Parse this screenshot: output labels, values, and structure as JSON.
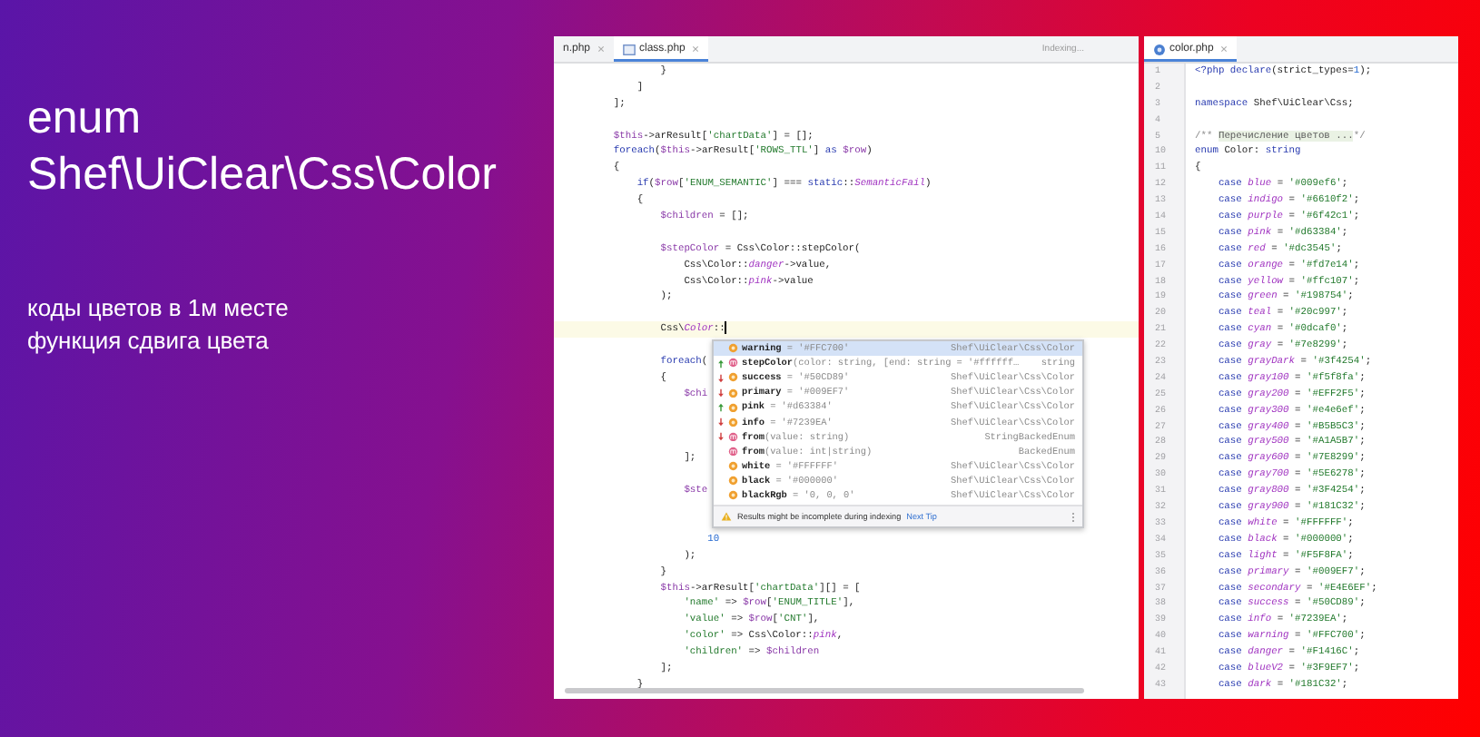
{
  "headline": [
    "enum",
    "Shef\\UiClear\\Css\\Color"
  ],
  "notes": [
    "коды цветов в 1м месте",
    "функция сдвига цвета"
  ],
  "left_editor": {
    "tabs": [
      {
        "label": "n.php",
        "selected": false
      },
      {
        "label": "class.php",
        "selected": true
      }
    ],
    "status": "Indexing...",
    "lines": [
      {
        "kind": "code",
        "current": false,
        "segments": [
          {
            "kind": "plain",
            "text": "                }"
          }
        ]
      },
      {
        "kind": "code",
        "current": false,
        "segments": [
          {
            "kind": "plain",
            "text": "            ]"
          }
        ]
      },
      {
        "kind": "code",
        "current": false,
        "segments": [
          {
            "kind": "plain",
            "text": "        ];"
          }
        ]
      },
      {
        "kind": "blank",
        "current": false
      },
      {
        "kind": "code",
        "current": false,
        "segments": [
          {
            "kind": "var",
            "text": "        $this"
          },
          {
            "kind": "plain",
            "text": "->arResult["
          },
          {
            "kind": "str",
            "text": "'chartData'"
          },
          {
            "kind": "plain",
            "text": "] = [];"
          }
        ]
      },
      {
        "kind": "code",
        "current": false,
        "segments": [
          {
            "kind": "kw",
            "text": "        foreach"
          },
          {
            "kind": "plain",
            "text": "("
          },
          {
            "kind": "var",
            "text": "$this"
          },
          {
            "kind": "plain",
            "text": "->arResult["
          },
          {
            "kind": "str",
            "text": "'ROWS_TTL'"
          },
          {
            "kind": "plain",
            "text": "] "
          },
          {
            "kind": "kw",
            "text": "as "
          },
          {
            "kind": "var",
            "text": "$row"
          },
          {
            "kind": "plain",
            "text": ")"
          }
        ]
      },
      {
        "kind": "code",
        "current": false,
        "segments": [
          {
            "kind": "plain",
            "text": "        {"
          }
        ]
      },
      {
        "kind": "code",
        "current": false,
        "segments": [
          {
            "kind": "kw",
            "text": "            if"
          },
          {
            "kind": "plain",
            "text": "("
          },
          {
            "kind": "var",
            "text": "$row"
          },
          {
            "kind": "plain",
            "text": "["
          },
          {
            "kind": "str",
            "text": "'ENUM_SEMANTIC'"
          },
          {
            "kind": "plain",
            "text": "] === "
          },
          {
            "kind": "kw",
            "text": "static"
          },
          {
            "kind": "plain",
            "text": "::"
          },
          {
            "kind": "const",
            "text": "SemanticFail"
          },
          {
            "kind": "plain",
            "text": ")"
          }
        ]
      },
      {
        "kind": "code",
        "current": false,
        "segments": [
          {
            "kind": "plain",
            "text": "            {"
          }
        ]
      },
      {
        "kind": "code",
        "current": false,
        "segments": [
          {
            "kind": "var",
            "text": "                $children"
          },
          {
            "kind": "plain",
            "text": " = [];"
          }
        ]
      },
      {
        "kind": "blank",
        "current": false
      },
      {
        "kind": "code",
        "current": false,
        "segments": [
          {
            "kind": "var",
            "text": "                $stepColor"
          },
          {
            "kind": "plain",
            "text": " = Css\\Color::stepColor("
          }
        ]
      },
      {
        "kind": "code",
        "current": false,
        "segments": [
          {
            "kind": "plain",
            "text": "                    Css\\Color::"
          },
          {
            "kind": "const",
            "text": "danger"
          },
          {
            "kind": "plain",
            "text": "->value,"
          }
        ]
      },
      {
        "kind": "code",
        "current": false,
        "segments": [
          {
            "kind": "plain",
            "text": "                    Css\\Color::"
          },
          {
            "kind": "const",
            "text": "pink"
          },
          {
            "kind": "plain",
            "text": "->value"
          }
        ]
      },
      {
        "kind": "code",
        "current": false,
        "segments": [
          {
            "kind": "plain",
            "text": "                );"
          }
        ]
      },
      {
        "kind": "blank",
        "current": false
      },
      {
        "kind": "code",
        "current": true,
        "segments": [
          {
            "kind": "plain",
            "text": "                Css\\"
          },
          {
            "kind": "const",
            "text": "Color"
          },
          {
            "kind": "plain",
            "text": "::"
          }
        ]
      },
      {
        "kind": "blank",
        "current": false
      },
      {
        "kind": "code",
        "current": false,
        "segments": [
          {
            "kind": "kw",
            "text": "                foreach"
          },
          {
            "kind": "plain",
            "text": "("
          }
        ]
      },
      {
        "kind": "code",
        "current": false,
        "segments": [
          {
            "kind": "plain",
            "text": "                {"
          }
        ]
      },
      {
        "kind": "code",
        "current": false,
        "segments": [
          {
            "kind": "var",
            "text": "                    $chi"
          }
        ]
      },
      {
        "kind": "blank",
        "current": false
      },
      {
        "kind": "blank",
        "current": false
      },
      {
        "kind": "blank",
        "current": false
      },
      {
        "kind": "code",
        "current": false,
        "segments": [
          {
            "kind": "plain",
            "text": "                    ];"
          }
        ]
      },
      {
        "kind": "blank",
        "current": false
      },
      {
        "kind": "code",
        "current": false,
        "segments": [
          {
            "kind": "var",
            "text": "                    $ste"
          }
        ]
      },
      {
        "kind": "blank",
        "current": false
      },
      {
        "kind": "blank",
        "current": false
      },
      {
        "kind": "code",
        "current": false,
        "segments": [
          {
            "kind": "num",
            "text": "                        10"
          }
        ]
      },
      {
        "kind": "code",
        "current": false,
        "segments": [
          {
            "kind": "plain",
            "text": "                    );"
          }
        ]
      },
      {
        "kind": "code",
        "current": false,
        "segments": [
          {
            "kind": "plain",
            "text": "                }"
          }
        ]
      },
      {
        "kind": "code",
        "current": false,
        "segments": [
          {
            "kind": "var",
            "text": "                $this"
          },
          {
            "kind": "plain",
            "text": "->arResult["
          },
          {
            "kind": "str",
            "text": "'chartData'"
          },
          {
            "kind": "plain",
            "text": "][] = ["
          }
        ]
      },
      {
        "kind": "code",
        "current": false,
        "segments": [
          {
            "kind": "str",
            "text": "                    'name'"
          },
          {
            "kind": "plain",
            "text": " => "
          },
          {
            "kind": "var",
            "text": "$row"
          },
          {
            "kind": "plain",
            "text": "["
          },
          {
            "kind": "str",
            "text": "'ENUM_TITLE'"
          },
          {
            "kind": "plain",
            "text": "],"
          }
        ]
      },
      {
        "kind": "code",
        "current": false,
        "segments": [
          {
            "kind": "str",
            "text": "                    'value'"
          },
          {
            "kind": "plain",
            "text": " => "
          },
          {
            "kind": "var",
            "text": "$row"
          },
          {
            "kind": "plain",
            "text": "["
          },
          {
            "kind": "str",
            "text": "'CNT'"
          },
          {
            "kind": "plain",
            "text": "],"
          }
        ]
      },
      {
        "kind": "code",
        "current": false,
        "segments": [
          {
            "kind": "str",
            "text": "                    'color'"
          },
          {
            "kind": "plain",
            "text": " => Css\\Color::"
          },
          {
            "kind": "const",
            "text": "pink"
          },
          {
            "kind": "plain",
            "text": ","
          }
        ]
      },
      {
        "kind": "code",
        "current": false,
        "segments": [
          {
            "kind": "str",
            "text": "                    'children'"
          },
          {
            "kind": "plain",
            "text": " => "
          },
          {
            "kind": "var",
            "text": "$children"
          }
        ]
      },
      {
        "kind": "code",
        "current": false,
        "segments": [
          {
            "kind": "plain",
            "text": "                ];"
          }
        ]
      },
      {
        "kind": "code",
        "current": false,
        "segments": [
          {
            "kind": "plain",
            "text": "            }"
          }
        ]
      }
    ],
    "completion": {
      "items": [
        {
          "kind": "field",
          "moved_up": false,
          "moved_down": false,
          "name": "warning",
          "detail": " = '#FFC700'",
          "type": "Shef\\UiClear\\Css\\Color",
          "selected": true
        },
        {
          "kind": "method",
          "moved_up": true,
          "moved_down": false,
          "name": "stepColor",
          "detail": "(color: string, [end: string = '#ffffff…",
          "type": "string",
          "selected": false
        },
        {
          "kind": "field",
          "moved_up": false,
          "moved_down": true,
          "name": "success",
          "detail": " = '#50CD89'",
          "type": "Shef\\UiClear\\Css\\Color",
          "selected": false
        },
        {
          "kind": "field",
          "moved_up": false,
          "moved_down": true,
          "name": "primary",
          "detail": " = '#009EF7'",
          "type": "Shef\\UiClear\\Css\\Color",
          "selected": false
        },
        {
          "kind": "field",
          "moved_up": true,
          "moved_down": false,
          "name": "pink",
          "detail": " = '#d63384'",
          "type": "Shef\\UiClear\\Css\\Color",
          "selected": false
        },
        {
          "kind": "field",
          "moved_up": false,
          "moved_down": true,
          "name": "info",
          "detail": " = '#7239EA'",
          "type": "Shef\\UiClear\\Css\\Color",
          "selected": false
        },
        {
          "kind": "method",
          "moved_up": false,
          "moved_down": true,
          "name": "from",
          "detail": "(value: string)",
          "type": "StringBackedEnum",
          "selected": false
        },
        {
          "kind": "method",
          "moved_up": false,
          "moved_down": false,
          "name": "from",
          "detail": "(value: int|string)",
          "type": "BackedEnum",
          "selected": false
        },
        {
          "kind": "field",
          "moved_up": false,
          "moved_down": false,
          "name": "white",
          "detail": " = '#FFFFFF'",
          "type": "Shef\\UiClear\\Css\\Color",
          "selected": false
        },
        {
          "kind": "field",
          "moved_up": false,
          "moved_down": false,
          "name": "black",
          "detail": " = '#000000'",
          "type": "Shef\\UiClear\\Css\\Color",
          "selected": false
        },
        {
          "kind": "field",
          "moved_up": false,
          "moved_down": false,
          "name": "blackRgb",
          "detail": " = '0, 0, 0'",
          "type": "Shef\\UiClear\\Css\\Color",
          "selected": false
        }
      ],
      "hint": "Results might be incomplete during indexing",
      "hint_link": "Next Tip"
    }
  },
  "right_editor": {
    "tabs": [
      {
        "label": "color.php",
        "selected": true
      }
    ],
    "lines": [
      {
        "number": "1",
        "segments": [
          {
            "kind": "kw",
            "text": "<?php declare"
          },
          {
            "kind": "plain",
            "text": "(strict_types="
          },
          {
            "kind": "num",
            "text": "1"
          },
          {
            "kind": "plain",
            "text": ");"
          }
        ]
      },
      {
        "number": "2"
      },
      {
        "number": "3",
        "segments": [
          {
            "kind": "kw",
            "text": "namespace"
          },
          {
            "kind": "plain",
            "text": " Shef\\UiClear\\Css;"
          }
        ]
      },
      {
        "number": "4"
      },
      {
        "number": "5",
        "segments": [
          {
            "kind": "comment",
            "text": "/** "
          },
          {
            "kind": "fold",
            "text": "Перечисление цветов ..."
          },
          {
            "kind": "comment",
            "text": "*/"
          }
        ]
      },
      {
        "number": "10",
        "segments": [
          {
            "kind": "kw",
            "text": "enum"
          },
          {
            "kind": "plain",
            "text": " Color: "
          },
          {
            "kind": "kw",
            "text": "string"
          }
        ]
      },
      {
        "number": "11",
        "segments": [
          {
            "kind": "plain",
            "text": "{"
          }
        ]
      },
      {
        "number": "12",
        "segments": [
          {
            "kind": "kw",
            "text": "    case "
          },
          {
            "kind": "const",
            "text": "blue"
          },
          {
            "kind": "plain",
            "text": " = "
          },
          {
            "kind": "str",
            "text": "'#009ef6'"
          },
          {
            "kind": "plain",
            "text": ";"
          }
        ]
      },
      {
        "number": "13",
        "segments": [
          {
            "kind": "kw",
            "text": "    case "
          },
          {
            "kind": "const",
            "text": "indigo"
          },
          {
            "kind": "plain",
            "text": " = "
          },
          {
            "kind": "str",
            "text": "'#6610f2'"
          },
          {
            "kind": "plain",
            "text": ";"
          }
        ]
      },
      {
        "number": "14",
        "segments": [
          {
            "kind": "kw",
            "text": "    case "
          },
          {
            "kind": "const",
            "text": "purple"
          },
          {
            "kind": "plain",
            "text": " = "
          },
          {
            "kind": "str",
            "text": "'#6f42c1'"
          },
          {
            "kind": "plain",
            "text": ";"
          }
        ]
      },
      {
        "number": "15",
        "segments": [
          {
            "kind": "kw",
            "text": "    case "
          },
          {
            "kind": "const",
            "text": "pink"
          },
          {
            "kind": "plain",
            "text": " = "
          },
          {
            "kind": "str",
            "text": "'#d63384'"
          },
          {
            "kind": "plain",
            "text": ";"
          }
        ]
      },
      {
        "number": "16",
        "segments": [
          {
            "kind": "kw",
            "text": "    case "
          },
          {
            "kind": "const",
            "text": "red"
          },
          {
            "kind": "plain",
            "text": " = "
          },
          {
            "kind": "str",
            "text": "'#dc3545'"
          },
          {
            "kind": "plain",
            "text": ";"
          }
        ]
      },
      {
        "number": "17",
        "segments": [
          {
            "kind": "kw",
            "text": "    case "
          },
          {
            "kind": "const",
            "text": "orange"
          },
          {
            "kind": "plain",
            "text": " = "
          },
          {
            "kind": "str",
            "text": "'#fd7e14'"
          },
          {
            "kind": "plain",
            "text": ";"
          }
        ]
      },
      {
        "number": "18",
        "segments": [
          {
            "kind": "kw",
            "text": "    case "
          },
          {
            "kind": "const",
            "text": "yellow"
          },
          {
            "kind": "plain",
            "text": " = "
          },
          {
            "kind": "str",
            "text": "'#ffc107'"
          },
          {
            "kind": "plain",
            "text": ";"
          }
        ]
      },
      {
        "number": "19",
        "segments": [
          {
            "kind": "kw",
            "text": "    case "
          },
          {
            "kind": "const",
            "text": "green"
          },
          {
            "kind": "plain",
            "text": " = "
          },
          {
            "kind": "str",
            "text": "'#198754'"
          },
          {
            "kind": "plain",
            "text": ";"
          }
        ]
      },
      {
        "number": "20",
        "segments": [
          {
            "kind": "kw",
            "text": "    case "
          },
          {
            "kind": "const",
            "text": "teal"
          },
          {
            "kind": "plain",
            "text": " = "
          },
          {
            "kind": "str",
            "text": "'#20c997'"
          },
          {
            "kind": "plain",
            "text": ";"
          }
        ]
      },
      {
        "number": "21",
        "segments": [
          {
            "kind": "kw",
            "text": "    case "
          },
          {
            "kind": "const",
            "text": "cyan"
          },
          {
            "kind": "plain",
            "text": " = "
          },
          {
            "kind": "str",
            "text": "'#0dcaf0'"
          },
          {
            "kind": "plain",
            "text": ";"
          }
        ]
      },
      {
        "number": "22",
        "segments": [
          {
            "kind": "kw",
            "text": "    case "
          },
          {
            "kind": "const",
            "text": "gray"
          },
          {
            "kind": "plain",
            "text": " = "
          },
          {
            "kind": "str",
            "text": "'#7e8299'"
          },
          {
            "kind": "plain",
            "text": ";"
          }
        ]
      },
      {
        "number": "23",
        "segments": [
          {
            "kind": "kw",
            "text": "    case "
          },
          {
            "kind": "const",
            "text": "grayDark"
          },
          {
            "kind": "plain",
            "text": " = "
          },
          {
            "kind": "str",
            "text": "'#3f4254'"
          },
          {
            "kind": "plain",
            "text": ";"
          }
        ]
      },
      {
        "number": "24",
        "segments": [
          {
            "kind": "kw",
            "text": "    case "
          },
          {
            "kind": "const",
            "text": "gray100"
          },
          {
            "kind": "plain",
            "text": " = "
          },
          {
            "kind": "str",
            "text": "'#f5f8fa'"
          },
          {
            "kind": "plain",
            "text": ";"
          }
        ]
      },
      {
        "number": "25",
        "segments": [
          {
            "kind": "kw",
            "text": "    case "
          },
          {
            "kind": "const",
            "text": "gray200"
          },
          {
            "kind": "plain",
            "text": " = "
          },
          {
            "kind": "str",
            "text": "'#EFF2F5'"
          },
          {
            "kind": "plain",
            "text": ";"
          }
        ]
      },
      {
        "number": "26",
        "segments": [
          {
            "kind": "kw",
            "text": "    case "
          },
          {
            "kind": "const",
            "text": "gray300"
          },
          {
            "kind": "plain",
            "text": " = "
          },
          {
            "kind": "str",
            "text": "'#e4e6ef'"
          },
          {
            "kind": "plain",
            "text": ";"
          }
        ]
      },
      {
        "number": "27",
        "segments": [
          {
            "kind": "kw",
            "text": "    case "
          },
          {
            "kind": "const",
            "text": "gray400"
          },
          {
            "kind": "plain",
            "text": " = "
          },
          {
            "kind": "str",
            "text": "'#B5B5C3'"
          },
          {
            "kind": "plain",
            "text": ";"
          }
        ]
      },
      {
        "number": "28",
        "segments": [
          {
            "kind": "kw",
            "text": "    case "
          },
          {
            "kind": "const",
            "text": "gray500"
          },
          {
            "kind": "plain",
            "text": " = "
          },
          {
            "kind": "str",
            "text": "'#A1A5B7'"
          },
          {
            "kind": "plain",
            "text": ";"
          }
        ]
      },
      {
        "number": "29",
        "segments": [
          {
            "kind": "kw",
            "text": "    case "
          },
          {
            "kind": "const",
            "text": "gray600"
          },
          {
            "kind": "plain",
            "text": " = "
          },
          {
            "kind": "str",
            "text": "'#7E8299'"
          },
          {
            "kind": "plain",
            "text": ";"
          }
        ]
      },
      {
        "number": "30",
        "segments": [
          {
            "kind": "kw",
            "text": "    case "
          },
          {
            "kind": "const",
            "text": "gray700"
          },
          {
            "kind": "plain",
            "text": " = "
          },
          {
            "kind": "str",
            "text": "'#5E6278'"
          },
          {
            "kind": "plain",
            "text": ";"
          }
        ]
      },
      {
        "number": "31",
        "segments": [
          {
            "kind": "kw",
            "text": "    case "
          },
          {
            "kind": "const",
            "text": "gray800"
          },
          {
            "kind": "plain",
            "text": " = "
          },
          {
            "kind": "str",
            "text": "'#3F4254'"
          },
          {
            "kind": "plain",
            "text": ";"
          }
        ]
      },
      {
        "number": "32",
        "segments": [
          {
            "kind": "kw",
            "text": "    case "
          },
          {
            "kind": "const",
            "text": "gray900"
          },
          {
            "kind": "plain",
            "text": " = "
          },
          {
            "kind": "str",
            "text": "'#181C32'"
          },
          {
            "kind": "plain",
            "text": ";"
          }
        ]
      },
      {
        "number": "33",
        "segments": [
          {
            "kind": "kw",
            "text": "    case "
          },
          {
            "kind": "const",
            "text": "white"
          },
          {
            "kind": "plain",
            "text": " = "
          },
          {
            "kind": "str",
            "text": "'#FFFFFF'"
          },
          {
            "kind": "plain",
            "text": ";"
          }
        ]
      },
      {
        "number": "34",
        "segments": [
          {
            "kind": "kw",
            "text": "    case "
          },
          {
            "kind": "const",
            "text": "black"
          },
          {
            "kind": "plain",
            "text": " = "
          },
          {
            "kind": "str",
            "text": "'#000000'"
          },
          {
            "kind": "plain",
            "text": ";"
          }
        ]
      },
      {
        "number": "35",
        "segments": [
          {
            "kind": "kw",
            "text": "    case "
          },
          {
            "kind": "const",
            "text": "light"
          },
          {
            "kind": "plain",
            "text": " = "
          },
          {
            "kind": "str",
            "text": "'#F5F8FA'"
          },
          {
            "kind": "plain",
            "text": ";"
          }
        ]
      },
      {
        "number": "36",
        "segments": [
          {
            "kind": "kw",
            "text": "    case "
          },
          {
            "kind": "const",
            "text": "primary"
          },
          {
            "kind": "plain",
            "text": " = "
          },
          {
            "kind": "str",
            "text": "'#009EF7'"
          },
          {
            "kind": "plain",
            "text": ";"
          }
        ]
      },
      {
        "number": "37",
        "segments": [
          {
            "kind": "kw",
            "text": "    case "
          },
          {
            "kind": "const",
            "text": "secondary"
          },
          {
            "kind": "plain",
            "text": " = "
          },
          {
            "kind": "str",
            "text": "'#E4E6EF'"
          },
          {
            "kind": "plain",
            "text": ";"
          }
        ]
      },
      {
        "number": "38",
        "segments": [
          {
            "kind": "kw",
            "text": "    case "
          },
          {
            "kind": "const",
            "text": "success"
          },
          {
            "kind": "plain",
            "text": " = "
          },
          {
            "kind": "str",
            "text": "'#50CD89'"
          },
          {
            "kind": "plain",
            "text": ";"
          }
        ]
      },
      {
        "number": "39",
        "segments": [
          {
            "kind": "kw",
            "text": "    case "
          },
          {
            "kind": "const",
            "text": "info"
          },
          {
            "kind": "plain",
            "text": " = "
          },
          {
            "kind": "str",
            "text": "'#7239EA'"
          },
          {
            "kind": "plain",
            "text": ";"
          }
        ]
      },
      {
        "number": "40",
        "segments": [
          {
            "kind": "kw",
            "text": "    case "
          },
          {
            "kind": "const",
            "text": "warning"
          },
          {
            "kind": "plain",
            "text": " = "
          },
          {
            "kind": "str",
            "text": "'#FFC700'"
          },
          {
            "kind": "plain",
            "text": ";"
          }
        ]
      },
      {
        "number": "41",
        "segments": [
          {
            "kind": "kw",
            "text": "    case "
          },
          {
            "kind": "const",
            "text": "danger"
          },
          {
            "kind": "plain",
            "text": " = "
          },
          {
            "kind": "str",
            "text": "'#F1416C'"
          },
          {
            "kind": "plain",
            "text": ";"
          }
        ]
      },
      {
        "number": "42",
        "segments": [
          {
            "kind": "kw",
            "text": "    case "
          },
          {
            "kind": "const",
            "text": "blueV2"
          },
          {
            "kind": "plain",
            "text": " = "
          },
          {
            "kind": "str",
            "text": "'#3F9EF7'"
          },
          {
            "kind": "plain",
            "text": ";"
          }
        ]
      },
      {
        "number": "43",
        "segments": [
          {
            "kind": "kw",
            "text": "    case "
          },
          {
            "kind": "const",
            "text": "dark"
          },
          {
            "kind": "plain",
            "text": " = "
          },
          {
            "kind": "str",
            "text": "'#181C32'"
          },
          {
            "kind": "plain",
            "text": ";"
          }
        ]
      }
    ]
  }
}
